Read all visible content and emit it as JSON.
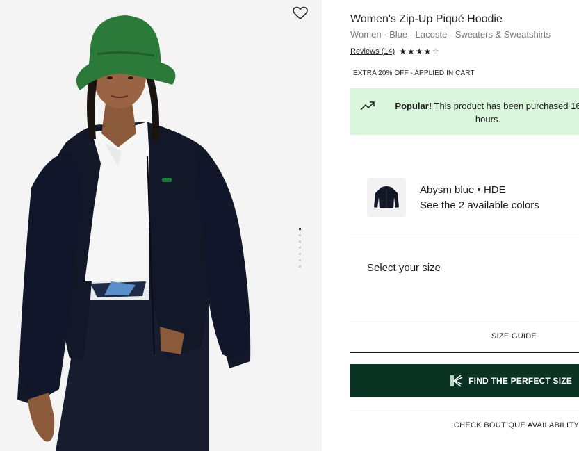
{
  "product": {
    "title": "Women's Zip-Up Piqué Hoodie",
    "breadcrumb": "Women - Blue - Lacoste - Sweaters & Sweatshirts",
    "reviews_label": "Reviews (14)",
    "rating": 4,
    "rating_max": 5
  },
  "promo": {
    "text": "EXTRA 20% OFF - APPLIED IN CART"
  },
  "popular": {
    "bold": "Popular!",
    "line1": " This product has been purchased 16",
    "line2": "hours.",
    "icon": "trending-up-icon",
    "bg_color": "#d9f5dc"
  },
  "color_selector": {
    "name": "Abysm blue • HDE",
    "link": "See the 2 available colors"
  },
  "size": {
    "label": "Select your size",
    "guide": "SIZE GUIDE"
  },
  "find_size_button": {
    "label": "FIND THE PERFECT SIZE",
    "bg_color": "#0b3323"
  },
  "boutique": {
    "label": "CHECK BOUTIQUE AVAILABILITY"
  },
  "gallery": {
    "image_count": 7,
    "active_index": 0,
    "wishlist_icon": "heart-outline-icon"
  }
}
